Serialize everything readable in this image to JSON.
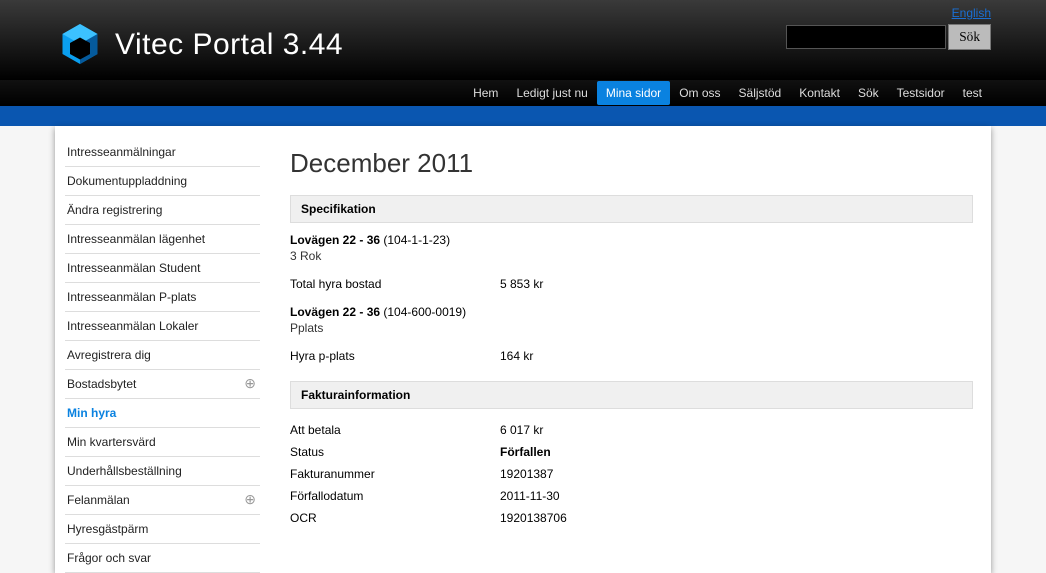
{
  "lang_link": "English",
  "search": {
    "button": "Sök",
    "value": ""
  },
  "logo_text": "Vitec Portal 3.44",
  "nav": [
    "Hem",
    "Ledigt just nu",
    "Mina sidor",
    "Om oss",
    "Säljstöd",
    "Kontakt",
    "Sök",
    "Testsidor",
    "test"
  ],
  "nav_active_index": 2,
  "sidebar": [
    {
      "label": "Intresseanmälningar"
    },
    {
      "label": "Dokumentuppladdning"
    },
    {
      "label": "Ändra registrering"
    },
    {
      "label": "Intresseanmälan lägenhet"
    },
    {
      "label": "Intresseanmälan Student"
    },
    {
      "label": "Intresseanmälan P-plats"
    },
    {
      "label": "Intresseanmälan Lokaler"
    },
    {
      "label": "Avregistrera dig"
    },
    {
      "label": "Bostadsbytet",
      "expand": true
    },
    {
      "label": "Min hyra",
      "active": true
    },
    {
      "label": "Min kvartersvärd"
    },
    {
      "label": "Underhållsbeställning"
    },
    {
      "label": "Felanmälan",
      "expand": true
    },
    {
      "label": "Hyresgästpärm"
    },
    {
      "label": "Frågor och svar"
    }
  ],
  "page_title": "December 2011",
  "spec_header": "Specifikation",
  "spec1_name": "Lovägen 22 - 36",
  "spec1_code": " (104-1-1-23)",
  "spec1_type": "3 Rok",
  "spec1_row_label": "Total hyra bostad",
  "spec1_row_value": "5 853 kr",
  "spec2_name": "Lovägen 22 - 36",
  "spec2_code": " (104-600-0019)",
  "spec2_type": "Pplats",
  "spec2_row_label": "Hyra p-plats",
  "spec2_row_value": "164 kr",
  "invoice_header": "Fakturainformation",
  "inv_rows": [
    {
      "label": "Att betala",
      "value": "6 017 kr"
    },
    {
      "label": "Status",
      "value": "Förfallen",
      "bold": true
    },
    {
      "label": "Fakturanummer",
      "value": "19201387"
    },
    {
      "label": "Förfallodatum",
      "value": "2011-11-30"
    },
    {
      "label": "OCR",
      "value": "1920138706"
    }
  ]
}
